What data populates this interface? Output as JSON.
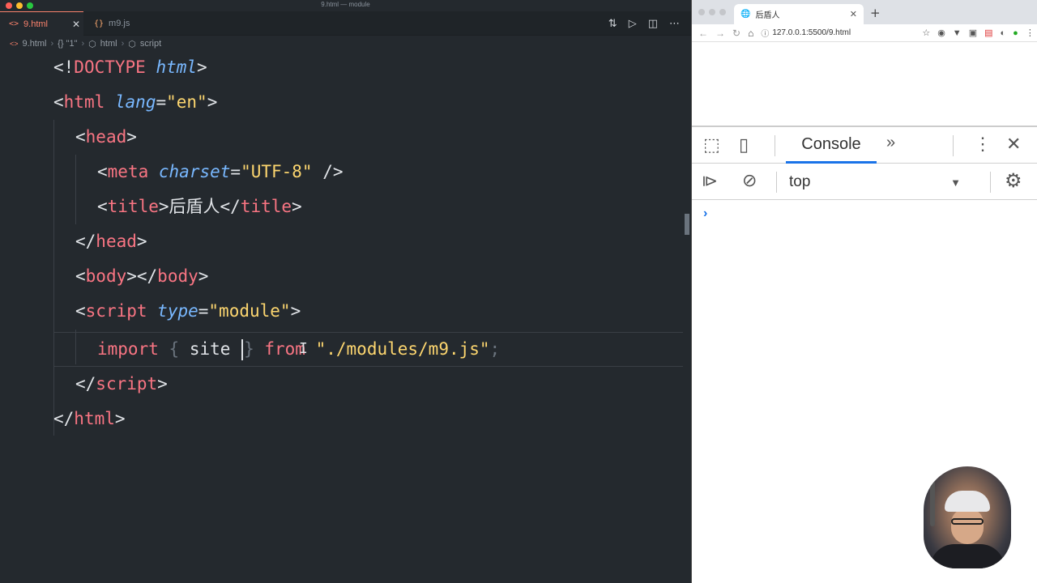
{
  "editor": {
    "window_title": "9.html — module",
    "tabs": [
      {
        "icon": "<>",
        "label": "9.html",
        "active": true
      },
      {
        "icon": "{}",
        "label": "m9.js",
        "active": false
      }
    ],
    "breadcrumb": [
      "9.html",
      "{} \"1\"",
      "html",
      "script"
    ],
    "code": {
      "l1_open": "<!",
      "l1_doctype": "DOCTYPE",
      "l1_html": "html",
      "l1_close": ">",
      "l2_open": "<",
      "l2_tag": "html",
      "l2_attr": "lang",
      "l2_eq": "=",
      "l2_val": "\"en\"",
      "l2_close": ">",
      "l3_open": "<",
      "l3_tag": "head",
      "l3_close": ">",
      "l4_open": "<",
      "l4_tag": "meta",
      "l4_attr": "charset",
      "l4_eq": "=",
      "l4_val": "\"UTF-8\"",
      "l4_close": " />",
      "l5_open": "<",
      "l5_tag": "title",
      "l5_gt": ">",
      "l5_text": "后盾人",
      "l5_close_open": "</",
      "l5_close_tag": "title",
      "l5_close": ">",
      "l6_open": "</",
      "l6_tag": "head",
      "l6_close": ">",
      "l7_open": "<",
      "l7_tag": "body",
      "l7_mid": "></",
      "l7_tag2": "body",
      "l7_close": ">",
      "l8_open": "<",
      "l8_tag": "script",
      "l8_attr": "type",
      "l8_eq": "=",
      "l8_val": "\"module\"",
      "l8_close": ">",
      "l9_kw": "import",
      "l9_lb": "{",
      "l9_name": "site",
      "l9_rb": "}",
      "l9_from": "from",
      "l9_path": "\"./modules/m9.js\"",
      "l9_semi": ";",
      "l10_open": "</",
      "l10_tag": "script",
      "l10_close": ">",
      "l11_open": "</",
      "l11_tag": "html",
      "l11_close": ">"
    }
  },
  "browser": {
    "tab_title": "后盾人",
    "url": "127.0.0.1:5500/9.html",
    "devtools": {
      "console_tab": "Console",
      "more": "»",
      "context": "top",
      "prompt": "›"
    }
  },
  "colors": {
    "accent_tab": "#f9826c",
    "tag": "#f97583",
    "attr": "#79b8ff",
    "string": "#fdd66f",
    "devtools_blue": "#1a73e8"
  }
}
